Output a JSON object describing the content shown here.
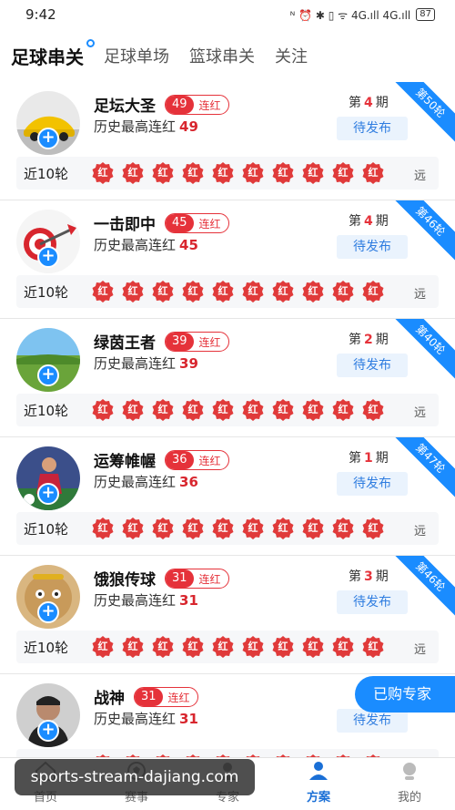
{
  "status_bar": {
    "time": "9:42",
    "signal_text": "ᴺ ⏰ ✱ ▯ ᯤ 4G.ıll 4G.ıll",
    "battery": "87"
  },
  "tabs": [
    {
      "label": "足球串关",
      "active": true
    },
    {
      "label": "足球单场",
      "active": false
    },
    {
      "label": "篮球串关",
      "active": false
    },
    {
      "label": "关注",
      "active": false
    }
  ],
  "labels": {
    "history": "历史最高连红",
    "streak_suffix": "连红",
    "period_prefix": "第",
    "period_suffix": "期",
    "pending": "待发布",
    "recent": "近10轮",
    "far": "远",
    "badge": "红"
  },
  "experts": [
    {
      "name": "足坛大圣",
      "streak": "49",
      "history": "49",
      "period": "4",
      "round": "第50轮",
      "avatar": "car-avatar-icon"
    },
    {
      "name": "一击即中",
      "streak": "45",
      "history": "45",
      "period": "4",
      "round": "第46轮",
      "avatar": "dart-target-icon"
    },
    {
      "name": "绿茵王者",
      "streak": "39",
      "history": "39",
      "period": "2",
      "round": "第40轮",
      "avatar": "grassland-avatar-icon"
    },
    {
      "name": "运筹帷幄",
      "streak": "36",
      "history": "36",
      "period": "1",
      "round": "第47轮",
      "avatar": "football-player-avatar-icon"
    },
    {
      "name": "饿狼传球",
      "streak": "31",
      "history": "31",
      "period": "3",
      "round": "第46轮",
      "avatar": "monkey-king-avatar-icon"
    },
    {
      "name": "战神",
      "streak": "31",
      "history": "31",
      "period": "",
      "round": "",
      "avatar": "man-portrait-avatar-icon"
    }
  ],
  "bought_button": "已购专家",
  "bottom_nav": [
    {
      "label": "首页",
      "icon": "home-icon",
      "active": false
    },
    {
      "label": "赛事",
      "icon": "match-icon",
      "active": false
    },
    {
      "label": "专家",
      "icon": "expert-icon",
      "active": false
    },
    {
      "label": "方案",
      "icon": "plan-icon",
      "active": true
    },
    {
      "label": "我的",
      "icon": "profile-icon",
      "active": false
    }
  ],
  "watermark": "sports-stream-dajiang.com",
  "colors": {
    "accent": "#1a8cff",
    "red": "#e5323a"
  }
}
